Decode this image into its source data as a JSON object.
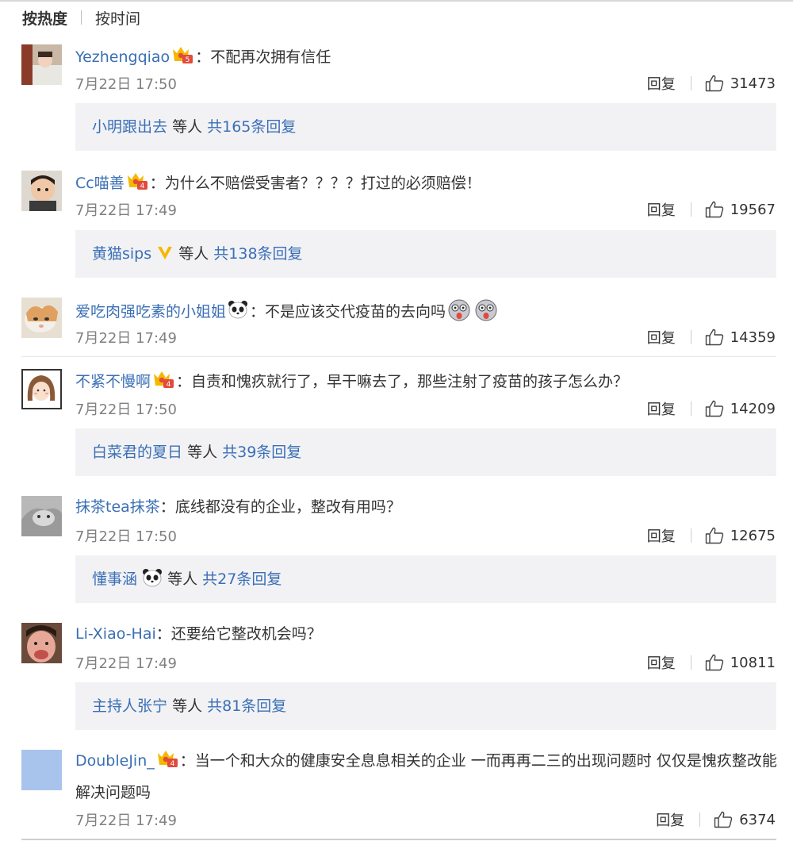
{
  "tabs": {
    "hot": "按热度",
    "time": "按时间"
  },
  "comments": [
    {
      "user": "Yezhengqiao",
      "colon": "：",
      "text": "不配再次拥有信任",
      "time": "7月22日 17:50",
      "reply": "回复",
      "likes": "31473",
      "sub": {
        "user": "小明跟出去",
        "others": "等人",
        "count": "共165条回复"
      }
    },
    {
      "user": "Cc喵善",
      "colon": "：",
      "text": "为什么不赔偿受害者？？？？打过的必须赔偿！",
      "time": "7月22日 17:49",
      "reply": "回复",
      "likes": "19567",
      "sub": {
        "user": "黄猫sips",
        "others": "等人",
        "count": "共138条回复"
      }
    },
    {
      "user": "爱吃肉强吃素的小姐姐",
      "colon": "：",
      "text": "不是应该交代疫苗的去向吗",
      "time": "7月22日 17:49",
      "reply": "回复",
      "likes": "14359"
    },
    {
      "user": "不紧不慢啊",
      "colon": "：",
      "text": "自责和愧疚就行了，早干嘛去了，那些注射了疫苗的孩子怎么办？",
      "time": "7月22日 17:50",
      "reply": "回复",
      "likes": "14209",
      "sub": {
        "user": "白菜君的夏日",
        "others": "等人",
        "count": "共39条回复"
      }
    },
    {
      "user": "抹茶tea抹茶",
      "colon": "：",
      "text": "底线都没有的企业，整改有用吗？",
      "time": "7月22日 17:50",
      "reply": "回复",
      "likes": "12675",
      "sub": {
        "user": "懂事涵",
        "others": "等人",
        "count": "共27条回复"
      }
    },
    {
      "user": "Li-Xiao-Hai",
      "colon": "：",
      "text": "还要给它整改机会吗？",
      "time": "7月22日 17:49",
      "reply": "回复",
      "likes": "10811",
      "sub": {
        "user": "主持人张宁",
        "others": "等人",
        "count": "共81条回复"
      }
    },
    {
      "user": "DoubleJin_",
      "colon": "：",
      "text": "当一个和大众的健康安全息息相关的企业 一而再再二三的出现问题时 仅仅是愧疚整改能解决问题吗",
      "time": "7月22日 17:49",
      "reply": "回复",
      "likes": "6374"
    }
  ],
  "colors": {
    "link": "#3a6fb5",
    "meta": "#808080",
    "sub_bg": "#f2f2f5",
    "vip_yellow": "#f5b800",
    "vip_red": "#e24a3b"
  },
  "icons": {
    "like": "thumb-up-icon",
    "vip": "crown-vip-icon",
    "verified": "v-verified-icon",
    "panda": "panda-emoji-icon",
    "emoji": "dizzy-face-emoji-icon"
  }
}
